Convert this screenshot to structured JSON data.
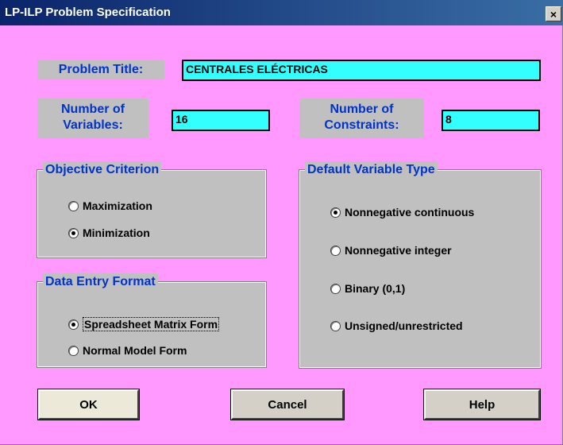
{
  "window": {
    "title": "LP-ILP Problem Specification",
    "close_glyph": "×"
  },
  "problem_title": {
    "label": "Problem Title:",
    "value": "CENTRALES ELÉCTRICAS"
  },
  "variables": {
    "label_line1": "Number of",
    "label_line2": "Variables:",
    "value": "16"
  },
  "constraints": {
    "label_line1": "Number of",
    "label_line2": "Constraints:",
    "value": "8"
  },
  "objective": {
    "title": "Objective Criterion",
    "options": [
      {
        "label": "Maximization",
        "selected": false
      },
      {
        "label": "Minimization",
        "selected": true
      }
    ]
  },
  "data_entry": {
    "title": "Data Entry Format",
    "options": [
      {
        "label": "Spreadsheet Matrix Form",
        "selected": true
      },
      {
        "label": "Normal Model Form",
        "selected": false
      }
    ]
  },
  "var_type": {
    "title": "Default Variable Type",
    "options": [
      {
        "label": "Nonnegative continuous",
        "selected": true
      },
      {
        "label": "Nonnegative integer",
        "selected": false
      },
      {
        "label": "Binary (0,1)",
        "selected": false
      },
      {
        "label": "Unsigned/unrestricted",
        "selected": false
      }
    ]
  },
  "buttons": {
    "ok": "OK",
    "cancel": "Cancel",
    "help": "Help"
  },
  "colors": {
    "background": "#ff99ff",
    "input": "#33ffff",
    "label_text": "#0033cc",
    "panel": "#c0c0c0"
  }
}
